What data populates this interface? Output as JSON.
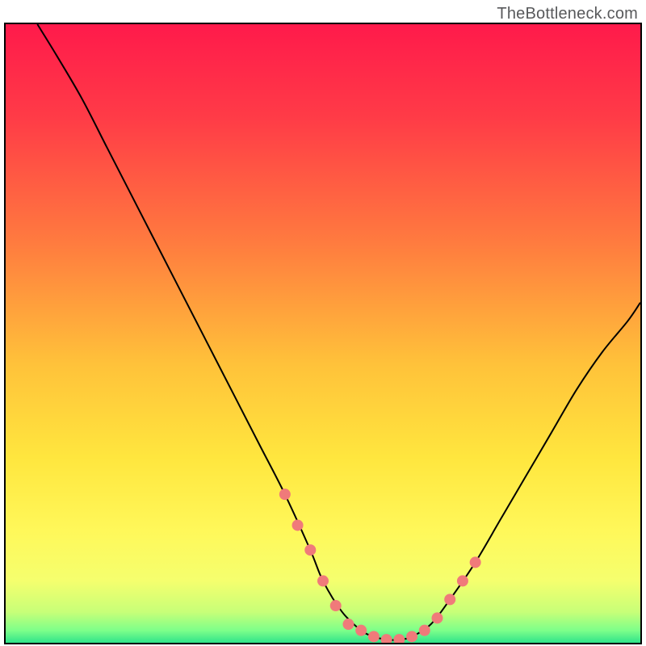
{
  "attribution": "TheBottleneck.com",
  "chart_data": {
    "type": "line",
    "title": "",
    "xlabel": "",
    "ylabel": "",
    "xlim": [
      0,
      100
    ],
    "ylim": [
      0,
      100
    ],
    "gradient_stops": [
      {
        "offset": 0.0,
        "color": "#ff1a4b"
      },
      {
        "offset": 0.15,
        "color": "#ff3b47"
      },
      {
        "offset": 0.35,
        "color": "#ff7a3f"
      },
      {
        "offset": 0.55,
        "color": "#ffc23a"
      },
      {
        "offset": 0.7,
        "color": "#ffe63e"
      },
      {
        "offset": 0.82,
        "color": "#fff85a"
      },
      {
        "offset": 0.9,
        "color": "#f5ff6e"
      },
      {
        "offset": 0.95,
        "color": "#c8ff78"
      },
      {
        "offset": 0.98,
        "color": "#7dff8a"
      },
      {
        "offset": 1.0,
        "color": "#30e38a"
      }
    ],
    "series": [
      {
        "name": "bottleneck-curve",
        "color": "#000000",
        "x": [
          5,
          8,
          12,
          16,
          20,
          24,
          28,
          32,
          36,
          40,
          44,
          48,
          50,
          53,
          56,
          58,
          60,
          62,
          64,
          67,
          70,
          74,
          78,
          82,
          86,
          90,
          94,
          98,
          100
        ],
        "y": [
          100,
          95,
          88,
          80,
          72,
          64,
          56,
          48,
          40,
          32,
          24,
          15,
          10,
          5,
          2,
          1,
          0.5,
          0.5,
          1,
          3,
          7,
          13,
          20,
          27,
          34,
          41,
          47,
          52,
          55
        ]
      }
    ],
    "markers": {
      "name": "highlighted-points",
      "color": "#f07a7a",
      "radius": 7,
      "x": [
        44,
        46,
        48,
        50,
        52,
        54,
        56,
        58,
        60,
        62,
        64,
        66,
        68,
        70,
        72,
        74
      ],
      "y": [
        24,
        19,
        15,
        10,
        6,
        3,
        2,
        1,
        0.5,
        0.5,
        1,
        2,
        4,
        7,
        10,
        13
      ]
    }
  }
}
